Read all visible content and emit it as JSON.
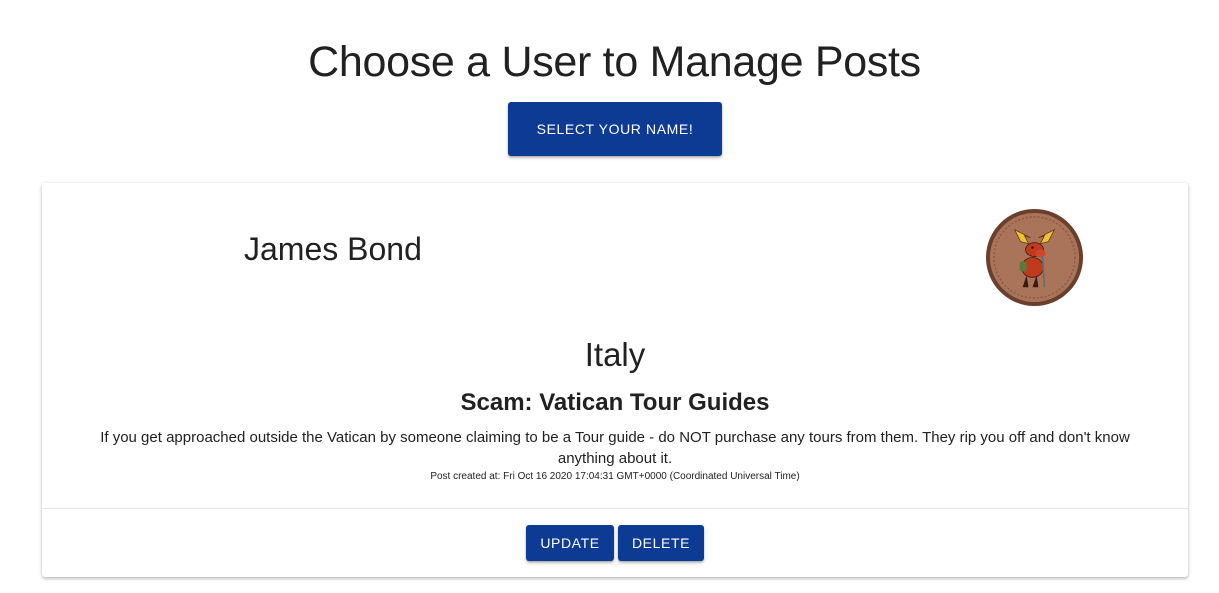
{
  "page": {
    "title": "Choose a User to Manage Posts",
    "select_button_label": "SELECT YOUR NAME!"
  },
  "colors": {
    "primary_button": "#0d3b94",
    "text": "#212121",
    "avatar_patch": "#a9745a",
    "avatar_border": "#6a3f2c"
  },
  "post": {
    "author": "James Bond",
    "avatar_icon": "moose-patch-icon",
    "country": "Italy",
    "title": "Scam: Vatican Tour Guides",
    "body": "If you get approached outside the Vatican by someone claiming to be a Tour guide - do NOT purchase any tours from them. They rip you off and don't know anything about it.",
    "created_at": "Post created at: Fri Oct 16 2020 17:04:31 GMT+0000 (Coordinated Universal Time)",
    "update_label": "UPDATE",
    "delete_label": "DELETE"
  }
}
